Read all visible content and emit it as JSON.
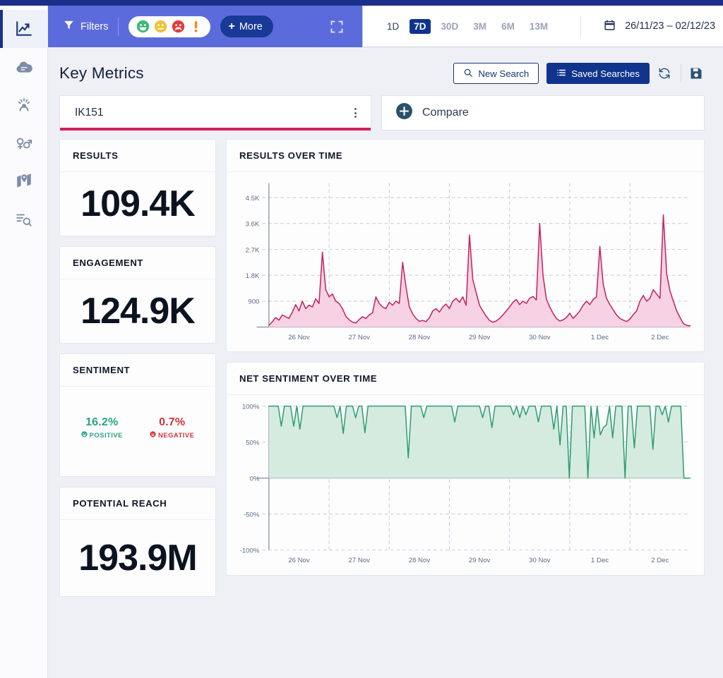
{
  "sidebar": {
    "items": [
      {
        "name": "analytics",
        "icon": "trending-chart-icon",
        "active": true
      },
      {
        "name": "word-cloud",
        "icon": "word-cloud-icon",
        "active": false
      },
      {
        "name": "influencers",
        "icon": "influencer-icon",
        "active": false
      },
      {
        "name": "demographics",
        "icon": "gender-symbols-icon",
        "active": false
      },
      {
        "name": "locations",
        "icon": "map-pin-icon",
        "active": false
      },
      {
        "name": "mentions",
        "icon": "list-search-icon",
        "active": false
      }
    ]
  },
  "filterbar": {
    "filters_label": "Filters",
    "sentiments": [
      "positive",
      "neutral",
      "negative",
      "unclassified"
    ],
    "more_label": "More",
    "expand_label": "expand"
  },
  "daterange": {
    "ranges": [
      {
        "label": "1D",
        "active": false
      },
      {
        "label": "7D",
        "active": true
      },
      {
        "label": "30D",
        "active": false
      },
      {
        "label": "3M",
        "active": false
      },
      {
        "label": "6M",
        "active": false
      },
      {
        "label": "13M",
        "active": false
      }
    ],
    "value": "26/11/23 – 02/12/23"
  },
  "header": {
    "title": "Key Metrics",
    "new_search_label": "New Search",
    "saved_searches_label": "Saved Searches",
    "refresh_label": "refresh",
    "save_label": "save"
  },
  "search": {
    "current": "IK151",
    "compare_label": "Compare"
  },
  "metrics": [
    {
      "title": "RESULTS",
      "value": "109.4K"
    },
    {
      "title": "ENGAGEMENT",
      "value": "124.9K"
    },
    {
      "title": "POTENTIAL REACH",
      "value": "193.9M"
    }
  ],
  "sentiment_card": {
    "title": "SENTIMENT",
    "positive": {
      "value": "16.2%",
      "label": "POSITIVE"
    },
    "negative": {
      "value": "0.7%",
      "label": "NEGATIVE"
    }
  },
  "colors": {
    "accent": "#d4205c",
    "brand": "#10348c",
    "filterbar": "#5c6bdc",
    "positive": "#2aa383",
    "negative": "#d03535",
    "sentiment_line": "#2f9e72",
    "sentiment_fill": "#d5ebdf"
  },
  "chart_data": [
    {
      "type": "area",
      "title": "RESULTS OVER TIME",
      "xlabel": "",
      "ylabel": "",
      "ylim": [
        0,
        5000
      ],
      "ytick_labels": [
        "900",
        "1.8K",
        "2.7K",
        "3.6K",
        "4.5K"
      ],
      "ytick_values": [
        900,
        1800,
        2700,
        3600,
        4500
      ],
      "xtick_labels": [
        "26 Nov",
        "27 Nov",
        "28 Nov",
        "29 Nov",
        "30 Nov",
        "1 Dec",
        "2 Dec"
      ],
      "grid": true,
      "legend": "none",
      "line_color": "#c7245f",
      "fill_color": "#f6d2e4",
      "series": [
        {
          "name": "Results",
          "values": [
            60,
            180,
            330,
            240,
            420,
            360,
            300,
            520,
            780,
            560,
            900,
            640,
            760,
            700,
            980,
            820,
            2600,
            1300,
            1050,
            1150,
            900,
            820,
            640,
            380,
            250,
            170,
            140,
            260,
            360,
            300,
            420,
            500,
            1050,
            820,
            700,
            640,
            860,
            760,
            900,
            820,
            2250,
            1400,
            700,
            460,
            300,
            200,
            230,
            190,
            320,
            560,
            640,
            520,
            700,
            800,
            640,
            900,
            1000,
            860,
            1050,
            760,
            3200,
            1650,
            1200,
            760,
            560,
            380,
            230,
            170,
            210,
            300,
            420,
            560,
            700,
            860,
            960,
            780,
            900,
            820,
            1000,
            1060,
            940,
            3600,
            1800,
            980,
            700,
            480,
            300,
            210,
            250,
            330,
            480,
            300,
            420,
            560,
            760,
            900,
            780,
            960,
            1050,
            2800,
            1500,
            1000,
            780,
            600,
            420,
            300,
            240,
            190,
            280,
            430,
            560,
            900,
            1100,
            900,
            1000,
            1300,
            1150,
            1000,
            3900,
            1850,
            1250,
            900,
            560,
            330,
            120,
            60,
            40
          ]
        }
      ]
    },
    {
      "type": "area",
      "title": "NET SENTIMENT OVER TIME",
      "xlabel": "",
      "ylabel": "",
      "ylim": [
        -100,
        100
      ],
      "ytick_labels": [
        "-100%",
        "-50%",
        "0%",
        "50%",
        "100%"
      ],
      "ytick_values": [
        -100,
        -50,
        0,
        50,
        100
      ],
      "xtick_labels": [
        "26 Nov",
        "27 Nov",
        "28 Nov",
        "29 Nov",
        "30 Nov",
        "1 Dec",
        "2 Dec"
      ],
      "grid": true,
      "legend": "none",
      "line_color": "#2f9e72",
      "fill_color": "#d5ebdf",
      "series": [
        {
          "name": "Net Sentiment",
          "values": [
            100,
            100,
            100,
            100,
            72,
            100,
            100,
            100,
            72,
            100,
            68,
            100,
            100,
            100,
            100,
            100,
            100,
            100,
            100,
            100,
            100,
            100,
            84,
            100,
            62,
            100,
            100,
            100,
            84,
            100,
            100,
            63,
            100,
            100,
            100,
            100,
            100,
            100,
            100,
            100,
            100,
            100,
            100,
            100,
            100,
            28,
            100,
            100,
            100,
            100,
            84,
            100,
            100,
            100,
            100,
            100,
            100,
            100,
            100,
            100,
            78,
            100,
            100,
            100,
            100,
            100,
            100,
            100,
            100,
            84,
            100,
            100,
            70,
            100,
            100,
            100,
            100,
            100,
            100,
            88,
            100,
            84,
            100,
            88,
            100,
            100,
            100,
            78,
            100,
            100,
            100,
            100,
            68,
            100,
            46,
            100,
            100,
            0,
            100,
            100,
            100,
            100,
            100,
            0,
            100,
            56,
            100,
            60,
            70,
            74,
            100,
            56,
            100,
            100,
            100,
            0,
            100,
            100,
            42,
            100,
            100,
            100,
            100,
            100,
            40,
            100,
            100,
            88,
            100,
            78,
            100,
            100,
            100,
            100,
            0,
            0,
            0
          ]
        }
      ]
    }
  ]
}
